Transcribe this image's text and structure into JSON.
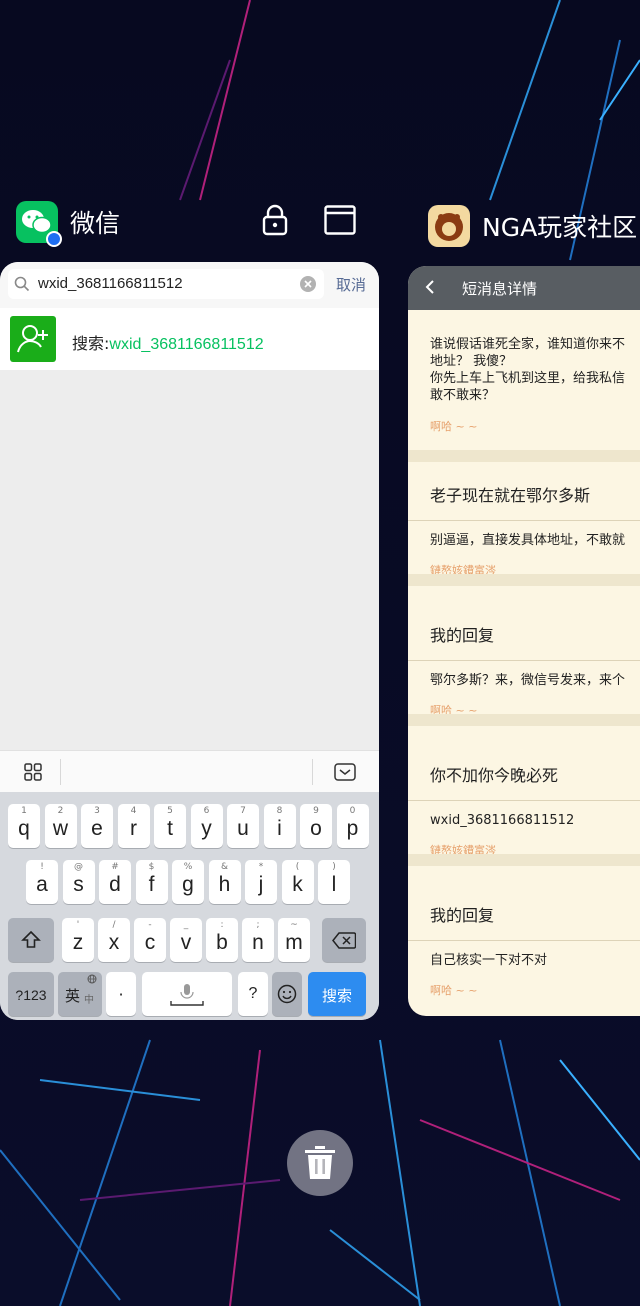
{
  "recents": {
    "wechat": {
      "app_name": "微信",
      "search": {
        "query": "wxid_3681166811512",
        "cancel_label": "取消"
      },
      "result": {
        "prefix": "搜索:",
        "highlight": "wxid_3681166811512"
      },
      "keyboard": {
        "row1": [
          {
            "sup": "1",
            "key": "q"
          },
          {
            "sup": "2",
            "key": "w"
          },
          {
            "sup": "3",
            "key": "e"
          },
          {
            "sup": "4",
            "key": "r"
          },
          {
            "sup": "5",
            "key": "t"
          },
          {
            "sup": "6",
            "key": "y"
          },
          {
            "sup": "7",
            "key": "u"
          },
          {
            "sup": "8",
            "key": "i"
          },
          {
            "sup": "9",
            "key": "o"
          },
          {
            "sup": "0",
            "key": "p"
          }
        ],
        "row2": [
          {
            "sup": "!",
            "key": "a"
          },
          {
            "sup": "@",
            "key": "s"
          },
          {
            "sup": "#",
            "key": "d"
          },
          {
            "sup": "$",
            "key": "f"
          },
          {
            "sup": "%",
            "key": "g"
          },
          {
            "sup": "&",
            "key": "h"
          },
          {
            "sup": "*",
            "key": "j"
          },
          {
            "sup": "(",
            "key": "k"
          },
          {
            "sup": ")",
            "key": "l"
          }
        ],
        "row3": [
          {
            "sup": "'",
            "key": "z"
          },
          {
            "sup": "/",
            "key": "x"
          },
          {
            "sup": "-",
            "key": "c"
          },
          {
            "sup": "_",
            "key": "v"
          },
          {
            "sup": ":",
            "key": "b"
          },
          {
            "sup": ";",
            "key": "n"
          },
          {
            "sup": "~",
            "key": "m"
          }
        ],
        "sym_label": "?123",
        "lang_label": "英",
        "lang_sub": "中",
        "dot_label": "·",
        "question_label": "?",
        "search_label": "搜索"
      }
    },
    "nga": {
      "app_name": "NGA玩家社区",
      "header_title": "短消息详情",
      "messages": [
        {
          "body": [
            "谁说假话谁死全家，谁知道你来不",
            "地址？ 我傻？",
            "你先上车上飞机到这里，给我私信",
            "敢不敢来？"
          ],
          "sign": "啊哈 ~ ~"
        },
        {
          "title": "老子现在就在鄂尔多斯",
          "body": [
            "别逼逼，直接发具体地址，不敢就"
          ],
          "sign": "鏈嶅姟鐨富涔"
        },
        {
          "title": "我的回复",
          "body": [
            "鄂尔多斯？来，微信号发来，来个"
          ],
          "sign": "啊哈 ~ ~"
        },
        {
          "title": "你不加你今晚必死",
          "body": [
            "wxid_3681166811512"
          ],
          "sign": "鏈嶅姟鐨富涔"
        },
        {
          "title": "我的回复",
          "body": [
            "自己核实一下对不对"
          ],
          "sign": "啊哈 ~ ~"
        }
      ]
    }
  },
  "colors": {
    "wechat_green": "#07c160",
    "nga_paper": "#fcf6e3",
    "nga_header": "#585d62",
    "nga_sign": "#e6a06b",
    "keyboard_blue": "#2d8cf0"
  }
}
